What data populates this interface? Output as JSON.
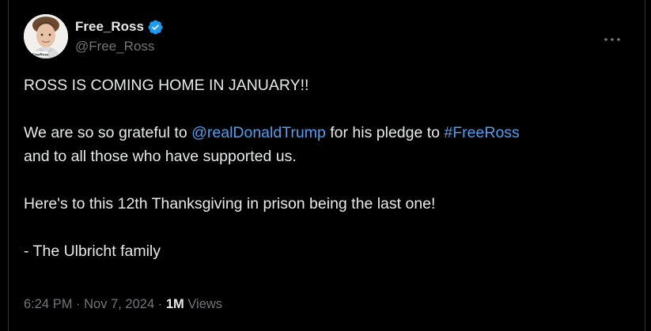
{
  "author": {
    "display_name": "Free_Ross",
    "handle": "@Free_Ross",
    "avatar_badge_text": "#FreeRoss",
    "verified_color": "#1d9bf0"
  },
  "tweet": {
    "line1": "ROSS IS COMING HOME IN JANUARY!!",
    "line2_prefix": "We are so so grateful to ",
    "mention": "@realDonaldTrump",
    "line2_middle": " for his pledge to ",
    "hashtag": "#FreeRoss",
    "line2_suffix": "and to all those who have supported us.",
    "line3": "Here's to this 12th Thanksgiving in prison being the last one!",
    "line4": "- The Ulbricht family"
  },
  "meta": {
    "time": "6:24 PM",
    "separator": "·",
    "date": "Nov 7, 2024",
    "views_count": "1M",
    "views_label": "Views"
  },
  "colors": {
    "background": "#000000",
    "text": "#e7e9ea",
    "secondary": "#71767b",
    "link": "#4d9ff0"
  }
}
